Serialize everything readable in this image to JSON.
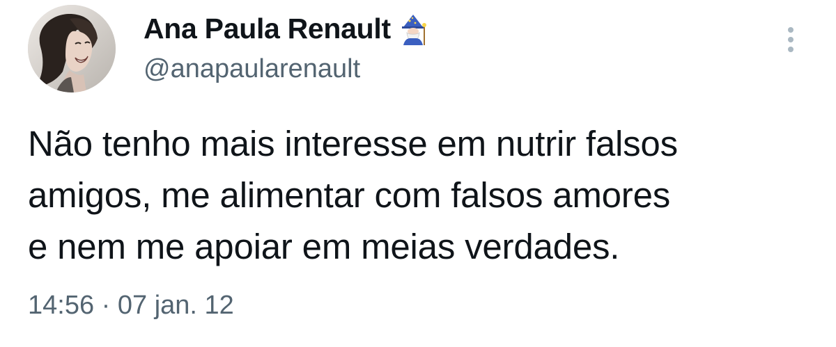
{
  "tweet": {
    "author": {
      "display_name": "Ana Paula Renault",
      "name_emoji": "wizard-emoji",
      "handle": "@anapaularenault",
      "avatar_icon": "profile-photo"
    },
    "text_lines": [
      "Não tenho mais interesse em nutrir falsos",
      "amigos, me alimentar com falsos amores",
      "e nem me apoiar em meias verdades."
    ],
    "timestamp": "14:56 · 07 jan. 12",
    "more_icon": "more-vertical-icon"
  },
  "colors": {
    "text": "#0f1419",
    "secondary": "#536471",
    "more_dots": "#aab8c2",
    "background": "#ffffff"
  }
}
